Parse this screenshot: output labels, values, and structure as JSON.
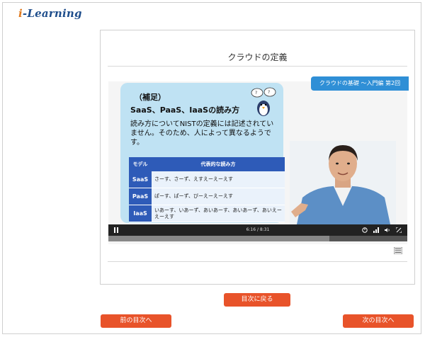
{
  "brand": {
    "logo_mark": "i",
    "logo_text": "-Learning"
  },
  "page": {
    "title": "クラウドの定義"
  },
  "course_badge": "クラウドの基礎 ～入門編 第2回",
  "slide": {
    "header": "（補足）",
    "title": "SaaS、PaaS、IaaSの読み方",
    "body": "読み方についてNISTの定義には記述されていません。そのため、人によって異なるようです。",
    "table": {
      "col_model": "モデル",
      "col_reading": "代表的な読み方",
      "rows": [
        {
          "model": "SaaS",
          "reading": "さーす、さーず、えすえーえーえす"
        },
        {
          "model": "PaaS",
          "reading": "ぱーす、ぱーず、ぴーえーえーえす"
        },
        {
          "model": "IaaS",
          "reading": "いあーす、いあーず、あいあーす、あいあーず、あいえーえーえす"
        }
      ]
    }
  },
  "player": {
    "time": "6:16 / 8:31",
    "progress": 0.74
  },
  "buttons": {
    "toc": "目次に戻る",
    "prev": "前の目次へ",
    "next": "次の目次へ"
  },
  "colors": {
    "accent": "#e8532a",
    "badge": "#2f8fd6",
    "table_head": "#2e5bb8",
    "slide_bg": "#bfe2f3"
  }
}
